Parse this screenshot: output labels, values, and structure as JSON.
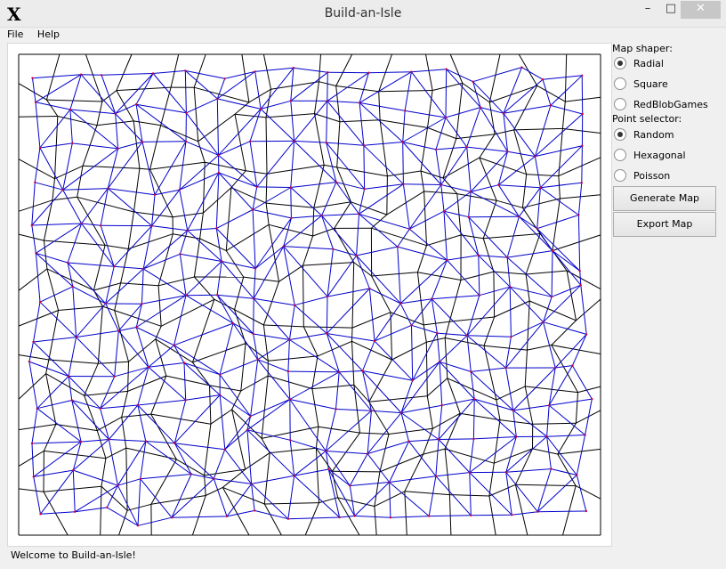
{
  "window": {
    "title": "Build-an-Isle",
    "logo": "X"
  },
  "controls": {
    "minimize": "–",
    "maximize": "□",
    "close": "✕"
  },
  "menu": {
    "file": "File",
    "help": "Help"
  },
  "map_shaper": {
    "label": "Map shaper:",
    "options": [
      "Radial",
      "Square",
      "RedBlobGames"
    ],
    "selected": "Radial"
  },
  "point_selector": {
    "label": "Point selector:",
    "options": [
      "Random",
      "Hexagonal",
      "Poisson"
    ],
    "selected": "Random"
  },
  "buttons": {
    "generate": "Generate Map",
    "export": "Export Map"
  },
  "status": "Welcome to Build-an-Isle!",
  "colors": {
    "voronoi": "#000000",
    "delaunay": "#0000cc",
    "points": "#cc0044"
  }
}
